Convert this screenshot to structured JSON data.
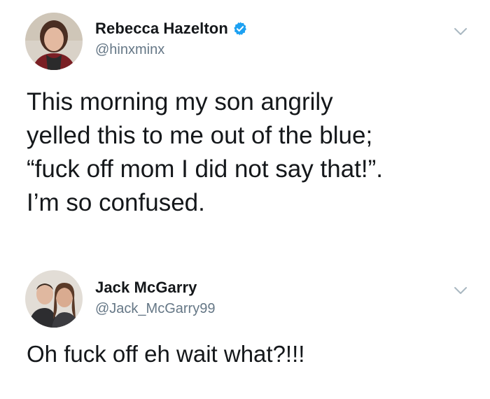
{
  "tweets": [
    {
      "display_name": "Rebecca Hazelton",
      "handle": "@hinxminx",
      "verified": true,
      "avatar_icon": "profile-photo-woman",
      "text": "This morning my son angrily\nyelled this to me out of the blue;\n“fuck off mom I did not say that!”.\nI’m so confused.",
      "menu_icon": "chevron-down-icon"
    },
    {
      "display_name": "Jack McGarry",
      "handle": "@Jack_McGarry99",
      "verified": false,
      "avatar_icon": "profile-photo-couple",
      "text": "Oh fuck off eh wait what?!!!",
      "menu_icon": "chevron-down-icon"
    }
  ],
  "colors": {
    "text_primary": "#14171a",
    "text_secondary": "#657786",
    "verified_blue": "#1da1f2",
    "chevron_gray": "#aab8c2"
  }
}
